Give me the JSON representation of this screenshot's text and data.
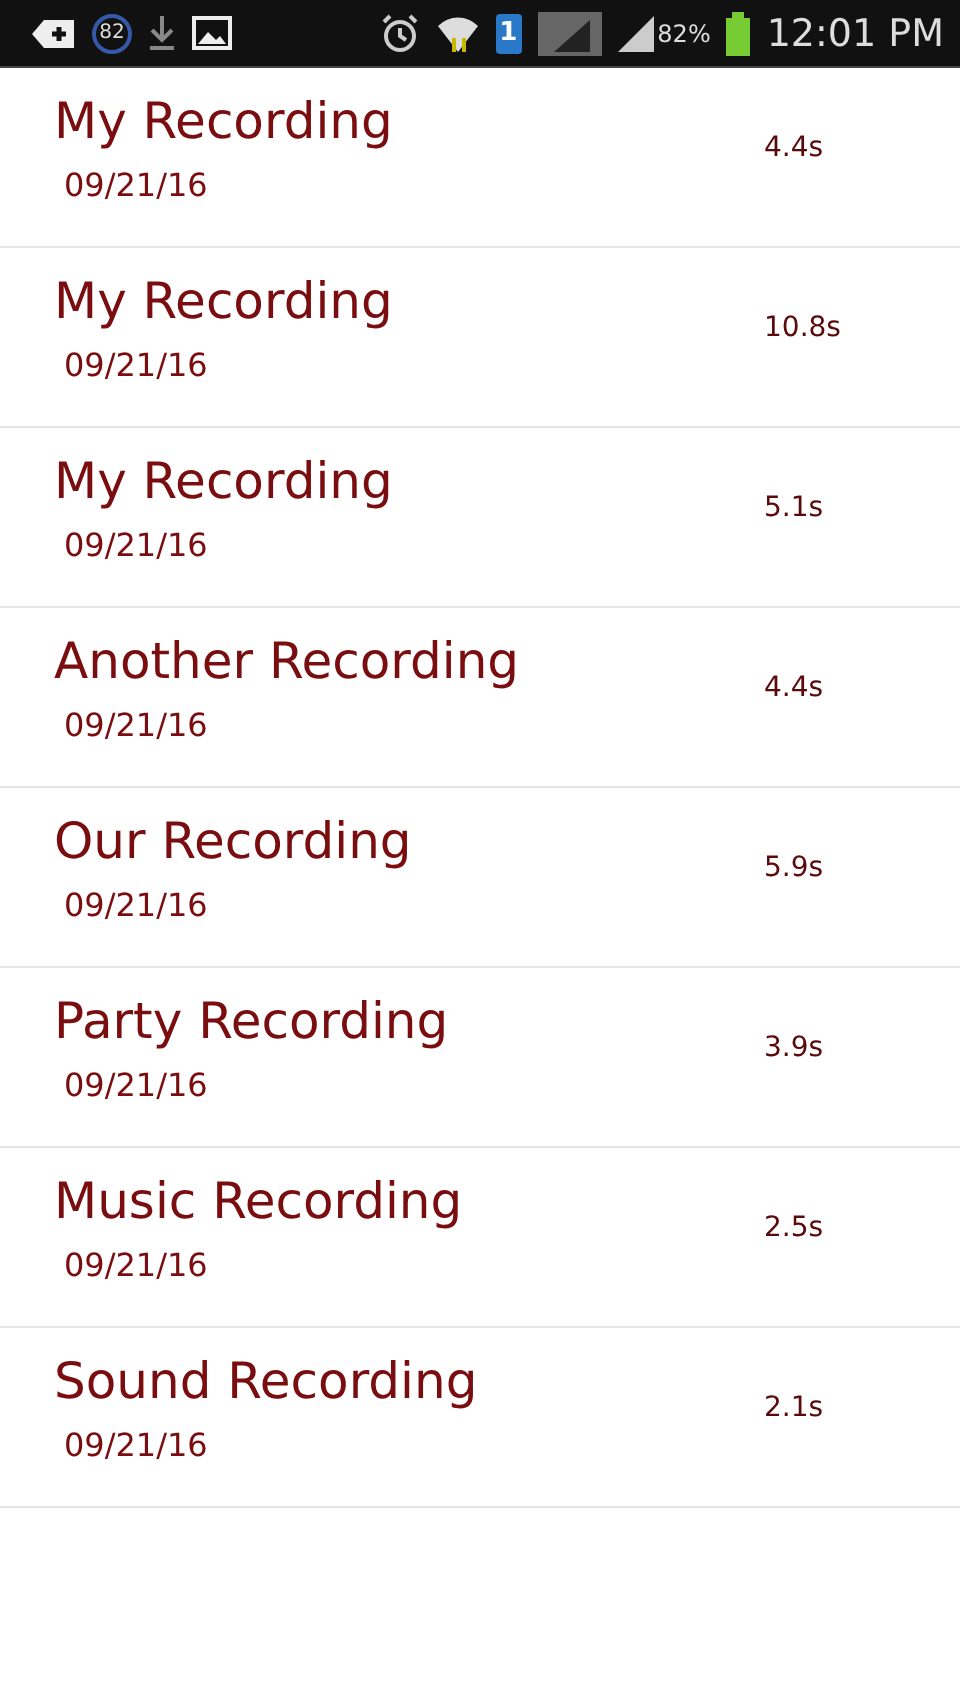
{
  "status_bar": {
    "notification_count": "82",
    "sim_number": "1",
    "battery_percent": "82%",
    "time": "12:01 PM"
  },
  "recordings": [
    {
      "title": "My Recording",
      "date": "09/21/16",
      "duration": "4.4s"
    },
    {
      "title": "My Recording",
      "date": "09/21/16",
      "duration": "10.8s"
    },
    {
      "title": "My Recording",
      "date": "09/21/16",
      "duration": "5.1s"
    },
    {
      "title": "Another Recording",
      "date": "09/21/16",
      "duration": "4.4s"
    },
    {
      "title": "Our Recording",
      "date": "09/21/16",
      "duration": "5.9s"
    },
    {
      "title": "Party Recording",
      "date": "09/21/16",
      "duration": "3.9s"
    },
    {
      "title": "Music Recording",
      "date": "09/21/16",
      "duration": "2.5s"
    },
    {
      "title": "Sound Recording",
      "date": "09/21/16",
      "duration": "2.1s"
    }
  ]
}
